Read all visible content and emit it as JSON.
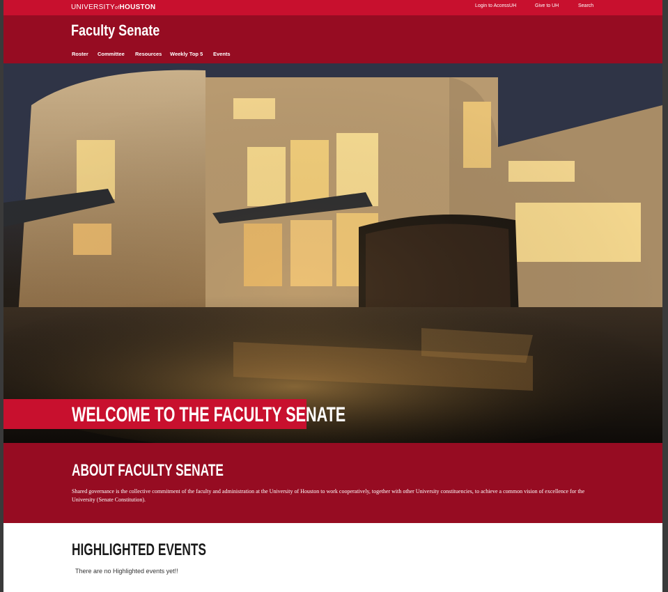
{
  "topbar": {
    "logo_university": "UNIVERSITY",
    "logo_of": "of",
    "logo_houston": "HOUSTON",
    "links": [
      "Login to AccessUH",
      "Give to UH",
      "Search"
    ]
  },
  "header": {
    "site_title": "Faculty Senate",
    "nav": [
      "Roster",
      "Committee",
      "Resources",
      "Weekly Top 5",
      "Events"
    ]
  },
  "hero": {
    "heading": "WELCOME TO THE FACULTY SENATE"
  },
  "about": {
    "title": "ABOUT FACULTY SENATE",
    "text": "Shared governance is the collective commitment of the faculty and administration at the University of Houston to work cooperatively, together with other University constituencies, to achieve a common vision of excellence for the University (Senate Constitution)."
  },
  "highlighted": {
    "title": "HIGHLIGHTED EVENTS",
    "empty_message": "There are no Highlighted events yet!!"
  },
  "colors": {
    "brand_red": "#c8102e",
    "dark_red": "#960c22"
  }
}
